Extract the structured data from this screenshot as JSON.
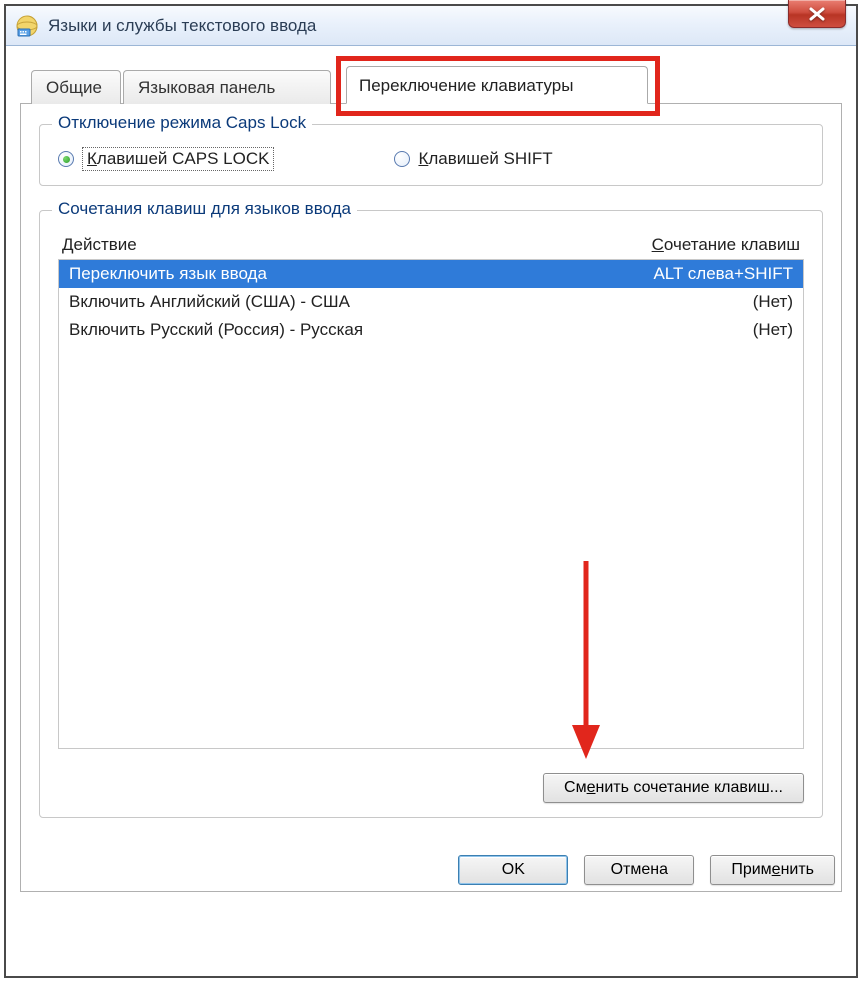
{
  "window": {
    "title": "Языки и службы текстового ввода"
  },
  "tabs": {
    "general": "Общие",
    "langbar": "Языковая панель",
    "switch": "Переключение клавиатуры"
  },
  "group_capslock": {
    "legend": "Отключение режима Caps Lock",
    "opt_caps_prefix": "К",
    "opt_caps_rest": "лавишей CAPS LOCK",
    "opt_shift_prefix": "К",
    "opt_shift_rest": "лавишей SHIFT"
  },
  "group_hotkeys": {
    "legend": "Сочетания клавиш для языков ввода",
    "col_action": "Действие",
    "col_combo_prefix": "С",
    "col_combo_rest": "очетание клавиш",
    "rows": [
      {
        "action": "Переключить язык ввода",
        "combo": "ALT слева+SHIFT"
      },
      {
        "action": "Включить Английский (США) - США",
        "combo": "(Нет)"
      },
      {
        "action": "Включить Русский (Россия) - Русская",
        "combo": "(Нет)"
      }
    ],
    "change_btn_pre": "См",
    "change_btn_key": "е",
    "change_btn_post": "нить сочетание клавиш..."
  },
  "dialog_buttons": {
    "ok": "OK",
    "cancel": "Отмена",
    "apply_pre": "Прим",
    "apply_key": "е",
    "apply_post": "нить"
  }
}
